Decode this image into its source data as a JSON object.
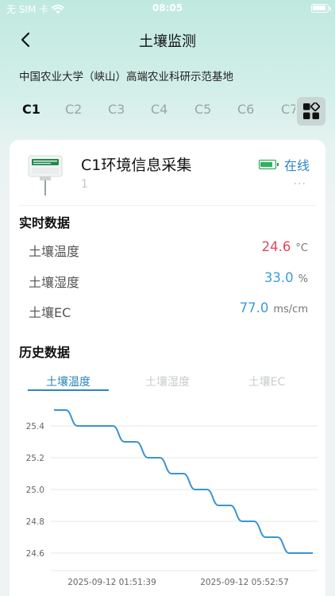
{
  "status": {
    "carrier": "无 SIM 卡",
    "time": "08:05"
  },
  "nav": {
    "title": "土壤监测"
  },
  "location": "中国农业大学（峡山）高端农业科研示范基地",
  "tabs": [
    "C1",
    "C2",
    "C3",
    "C4",
    "C5",
    "C6",
    "C7"
  ],
  "active_tab": "C1",
  "device": {
    "name": "C1环境信息采集",
    "sub": "1",
    "status": "在线",
    "more": "···"
  },
  "realtime": {
    "title": "实时数据",
    "rows": [
      {
        "label": "土壤温度",
        "value": "24.6",
        "unit": "°C",
        "color": "#e0475e"
      },
      {
        "label": "土壤湿度",
        "value": "33.0",
        "unit": "%",
        "color": "#3d9be0"
      },
      {
        "label": "土壤EC",
        "value": "77.0",
        "unit": "ms/cm",
        "color": "#3d9be0"
      }
    ]
  },
  "history": {
    "title": "历史数据",
    "tabs": [
      "土壤温度",
      "土壤湿度",
      "土壤EC"
    ],
    "active": "土壤温度"
  },
  "chart_data": {
    "type": "line",
    "ylim": [
      24.5,
      25.5
    ],
    "yticks": [
      24.6,
      24.8,
      25.0,
      25.2,
      25.4
    ],
    "xtick_labels": [
      "2025-09-12 01:51:39",
      "2025-09-12 05:52:57"
    ],
    "series": [
      {
        "color": "#3a93d5",
        "values": [
          25.5,
          25.5,
          25.4,
          25.4,
          25.4,
          25.4,
          25.3,
          25.3,
          25.2,
          25.2,
          25.1,
          25.1,
          25.0,
          25.0,
          24.9,
          24.9,
          24.8,
          24.8,
          24.7,
          24.7,
          24.6,
          24.6,
          24.6
        ]
      }
    ]
  },
  "colors": {
    "accent": "#2e86b8",
    "online": "#2f86c8",
    "temp": "#e0475e"
  }
}
